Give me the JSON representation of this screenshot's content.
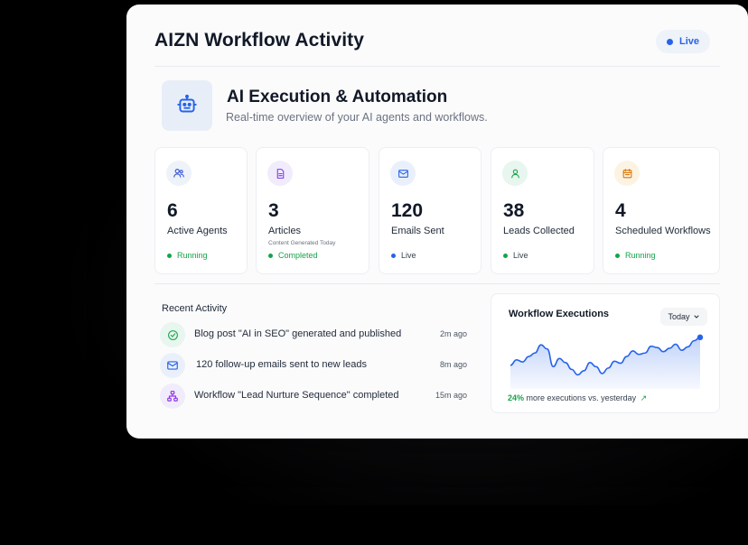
{
  "window": {
    "title": "AIZN Workflow Activity",
    "live_label": "Live"
  },
  "hero": {
    "icon": "robot-icon",
    "title": "AI Execution & Automation",
    "subtitle": "Real-time overview of your AI agents and workflows."
  },
  "stats": [
    {
      "icon": "users-icon",
      "value": "6",
      "label": "Active Agents",
      "sublabel": "",
      "status": "Running",
      "status_color": "#16a34a",
      "icon_bg": "#eef2f9",
      "icon_color": "#3b5bdb"
    },
    {
      "icon": "document-icon",
      "value": "3",
      "label": "Articles",
      "sublabel": "Content Generated Today",
      "status": "Completed",
      "status_color": "#16a34a",
      "icon_bg": "#f1ecfb",
      "icon_color": "#7c3aed"
    },
    {
      "icon": "mail-icon",
      "value": "120",
      "label": "Emails Sent",
      "sublabel": "",
      "status": "Live",
      "status_color": "#2563eb",
      "icon_bg": "#eaf0fb",
      "icon_color": "#2563eb"
    },
    {
      "icon": "user-icon",
      "value": "38",
      "label": "Leads Collected",
      "sublabel": "",
      "status": "Live",
      "status_color": "#16a34a",
      "icon_bg": "#e7f6ee",
      "icon_color": "#16a34a"
    },
    {
      "icon": "calendar-icon",
      "value": "4",
      "label": "Scheduled Workflows",
      "sublabel": "",
      "status": "Running",
      "status_color": "#16a34a",
      "icon_bg": "#fdf3e3",
      "icon_color": "#d97706"
    }
  ],
  "recent": {
    "title": "Recent Activity",
    "items": [
      {
        "icon": "check-circle-icon",
        "text": "Blog post \"AI in SEO\" generated and published",
        "time": "2m ago"
      },
      {
        "icon": "mail-icon",
        "text": "120 follow-up emails sent to new leads",
        "time": "8m ago"
      },
      {
        "icon": "workflow-icon",
        "text": "Workflow \"Lead Nurture Sequence\" completed",
        "time": "15m ago"
      }
    ]
  },
  "chart": {
    "title": "Workflow Executions",
    "period": "Today",
    "footer_pct": "24%",
    "footer_text": "more executions vs. yesterday",
    "line_color": "#2563eb"
  },
  "chart_data": {
    "type": "area",
    "title": "Workflow Executions",
    "values": [
      42,
      50,
      47,
      55,
      60,
      72,
      66,
      40,
      52,
      46,
      36,
      28,
      34,
      46,
      40,
      30,
      38,
      48,
      45,
      55,
      63,
      58,
      60,
      70,
      68,
      62,
      67,
      73,
      64,
      69,
      78,
      83
    ],
    "ylim": [
      0,
      100
    ],
    "grid": false
  }
}
